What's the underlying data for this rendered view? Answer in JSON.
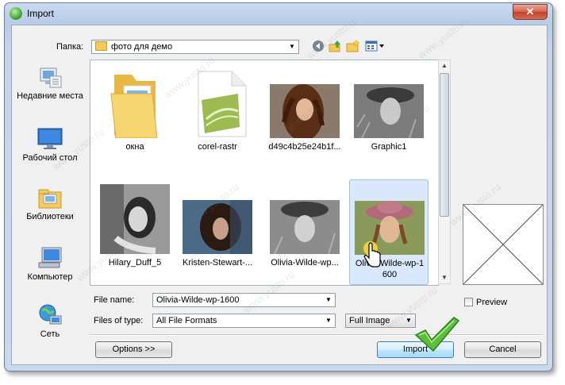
{
  "window": {
    "title": "Import",
    "close_label": "✕"
  },
  "toolbar": {
    "folder_label": "Папка:",
    "folder_value": "фото для демо"
  },
  "places": [
    {
      "label": "Недавние места",
      "icon": "recent-places-icon"
    },
    {
      "label": "Рабочий стол",
      "icon": "desktop-icon"
    },
    {
      "label": "Библиотеки",
      "icon": "libraries-icon"
    },
    {
      "label": "Компьютер",
      "icon": "computer-icon"
    },
    {
      "label": "Сеть",
      "icon": "network-icon"
    }
  ],
  "files": [
    {
      "name": "окна",
      "kind": "folder"
    },
    {
      "name": "corel-rastr",
      "kind": "file"
    },
    {
      "name": "d49c4b25e24b1f...",
      "kind": "image"
    },
    {
      "name": "Graphic1",
      "kind": "image"
    },
    {
      "name": "Hilary_Duff_5",
      "kind": "image"
    },
    {
      "name": "Kristen-Stewart-...",
      "kind": "image"
    },
    {
      "name": "Olivia-Wilde-wp...",
      "kind": "image"
    },
    {
      "name_line1": "Olivia-Wilde-wp-1",
      "name_line2": "600",
      "kind": "image",
      "selected": true
    }
  ],
  "form": {
    "file_name_label": "File name:",
    "file_name_value": "Olivia-Wilde-wp-1600",
    "files_of_type_label": "Files of type:",
    "files_of_type_value": "All File Formats",
    "mode_value": "Full Image",
    "preview_label": "Preview",
    "preview_checked": false
  },
  "buttons": {
    "options": "Options >>",
    "import": "Import",
    "cancel": "Cancel"
  },
  "watermark": "www.yusto.ru",
  "colors": {
    "title_bar": "#c9daf0",
    "close_button": "#d8614a",
    "selection": "#d9e8fb",
    "checkmark": "#5bbf3a"
  }
}
